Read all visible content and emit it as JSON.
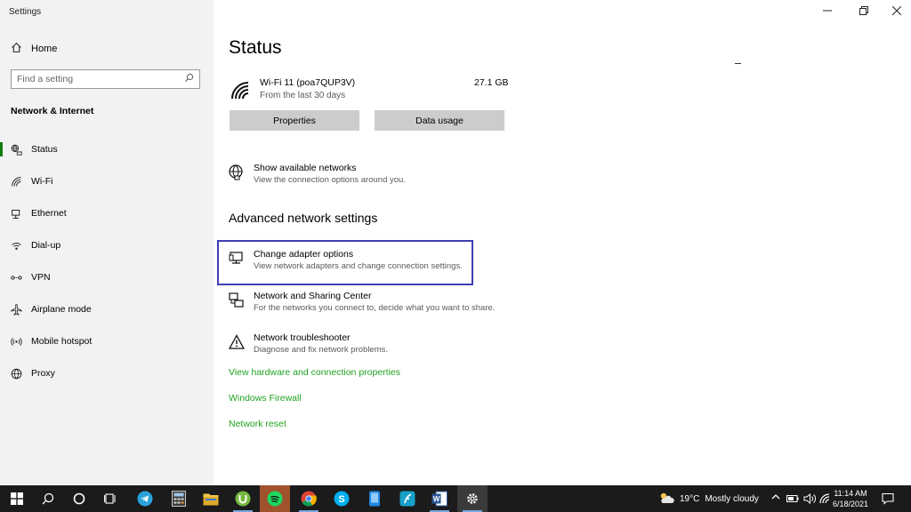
{
  "app": {
    "title": "Settings"
  },
  "sidebar": {
    "home_label": "Home",
    "search_placeholder": "Find a setting",
    "section_title": "Network & Internet",
    "items": [
      {
        "label": "Status",
        "icon": "status-icon",
        "active": true
      },
      {
        "label": "Wi-Fi",
        "icon": "wifi-icon"
      },
      {
        "label": "Ethernet",
        "icon": "ethernet-icon"
      },
      {
        "label": "Dial-up",
        "icon": "dialup-icon"
      },
      {
        "label": "VPN",
        "icon": "vpn-icon"
      },
      {
        "label": "Airplane mode",
        "icon": "airplane-icon"
      },
      {
        "label": "Mobile hotspot",
        "icon": "hotspot-icon"
      },
      {
        "label": "Proxy",
        "icon": "globe-icon"
      }
    ]
  },
  "main": {
    "title": "Status",
    "network": {
      "name": "Wi-Fi 11 (poa7QUP3V)",
      "period": "From the last 30 days",
      "usage": "27.1 GB"
    },
    "buttons": {
      "properties": "Properties",
      "data_usage": "Data usage"
    },
    "show_networks": {
      "title": "Show available networks",
      "desc": "View the connection options around you."
    },
    "advanced_title": "Advanced network settings",
    "options": [
      {
        "title": "Change adapter options",
        "desc": "View network adapters and change connection settings."
      },
      {
        "title": "Network and Sharing Center",
        "desc": "For the networks you connect to, decide what you want to share."
      },
      {
        "title": "Network troubleshooter",
        "desc": "Diagnose and fix network problems."
      }
    ],
    "links": [
      "View hardware and connection properties",
      "Windows Firewall",
      "Network reset"
    ]
  },
  "colors": {
    "accent_green": "#107c10",
    "link_green": "#21a321",
    "highlight_border": "#3f3fb3",
    "taskbar": "#1b1b1b"
  },
  "taskbar": {
    "apps": [
      "windows-start-icon",
      "search-icon",
      "cortana-icon",
      "task-view-icon",
      "telegram-icon",
      "calculator-icon",
      "file-explorer-icon",
      "utorrent-icon",
      "spotify-icon",
      "chrome-icon",
      "skype-icon",
      "phone-icon",
      "foxit-icon",
      "word-icon",
      "settings-icon"
    ],
    "weather": {
      "temp": "19°C",
      "condition": "Mostly cloudy"
    },
    "clock": {
      "time": "11:14 AM",
      "date": "6/18/2021"
    }
  }
}
